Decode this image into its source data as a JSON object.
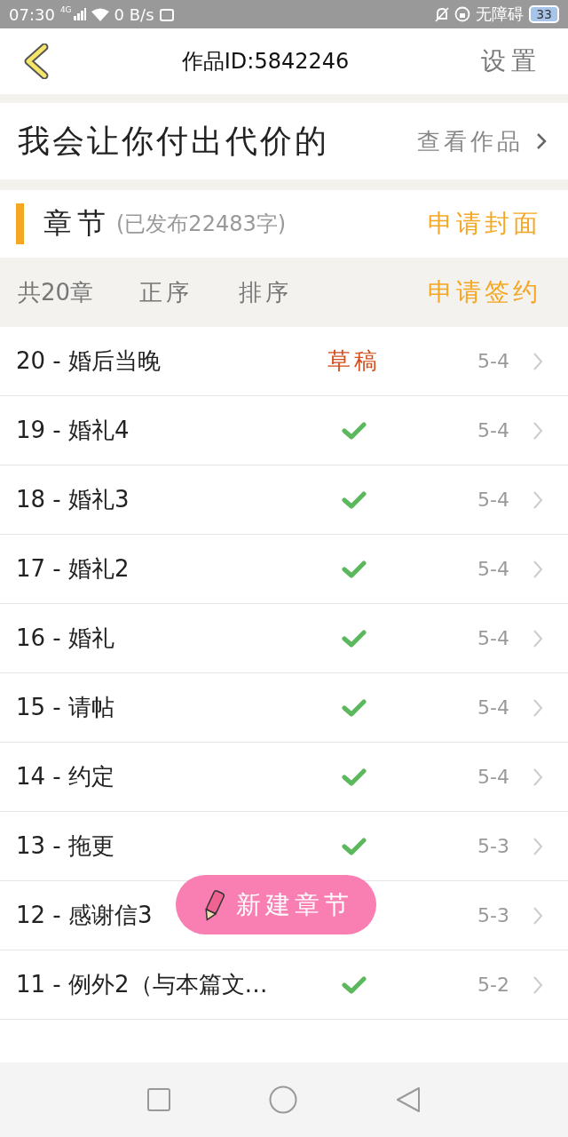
{
  "status_bar": {
    "time": "07:30",
    "network": "4G",
    "speed": "0 B/s",
    "accessibility": "无障碍",
    "battery": "33"
  },
  "header": {
    "title": "作品ID:5842246",
    "settings": "设置"
  },
  "work": {
    "title": "我会让你付出代价的",
    "view": "查看作品"
  },
  "chapters": {
    "title": "章节",
    "published": "(已发布22483字)",
    "apply_cover": "申请封面"
  },
  "sort_bar": {
    "count": "共20章",
    "order": "正序",
    "sort": "排序",
    "apply_contract": "申请签约"
  },
  "rows": [
    {
      "title": "20 - 婚后当晚",
      "kind": "draft",
      "status_text": "草稿",
      "date": "5-4"
    },
    {
      "title": "19 - 婚礼4",
      "kind": "published",
      "date": "5-4"
    },
    {
      "title": "18 - 婚礼3",
      "kind": "published",
      "date": "5-4"
    },
    {
      "title": "17 - 婚礼2",
      "kind": "published",
      "date": "5-4"
    },
    {
      "title": "16 - 婚礼",
      "kind": "published",
      "date": "5-4"
    },
    {
      "title": "15 - 请帖",
      "kind": "published",
      "date": "5-4"
    },
    {
      "title": "14 - 约定",
      "kind": "published",
      "date": "5-4"
    },
    {
      "title": "13 - 拖更",
      "kind": "published",
      "date": "5-3"
    },
    {
      "title": "12 - 感谢信3",
      "date": "5-3"
    },
    {
      "title": "11 - 例外2（与本篇文…",
      "kind": "published",
      "date": "5-2"
    }
  ],
  "new_chapter_button": "新建章节"
}
